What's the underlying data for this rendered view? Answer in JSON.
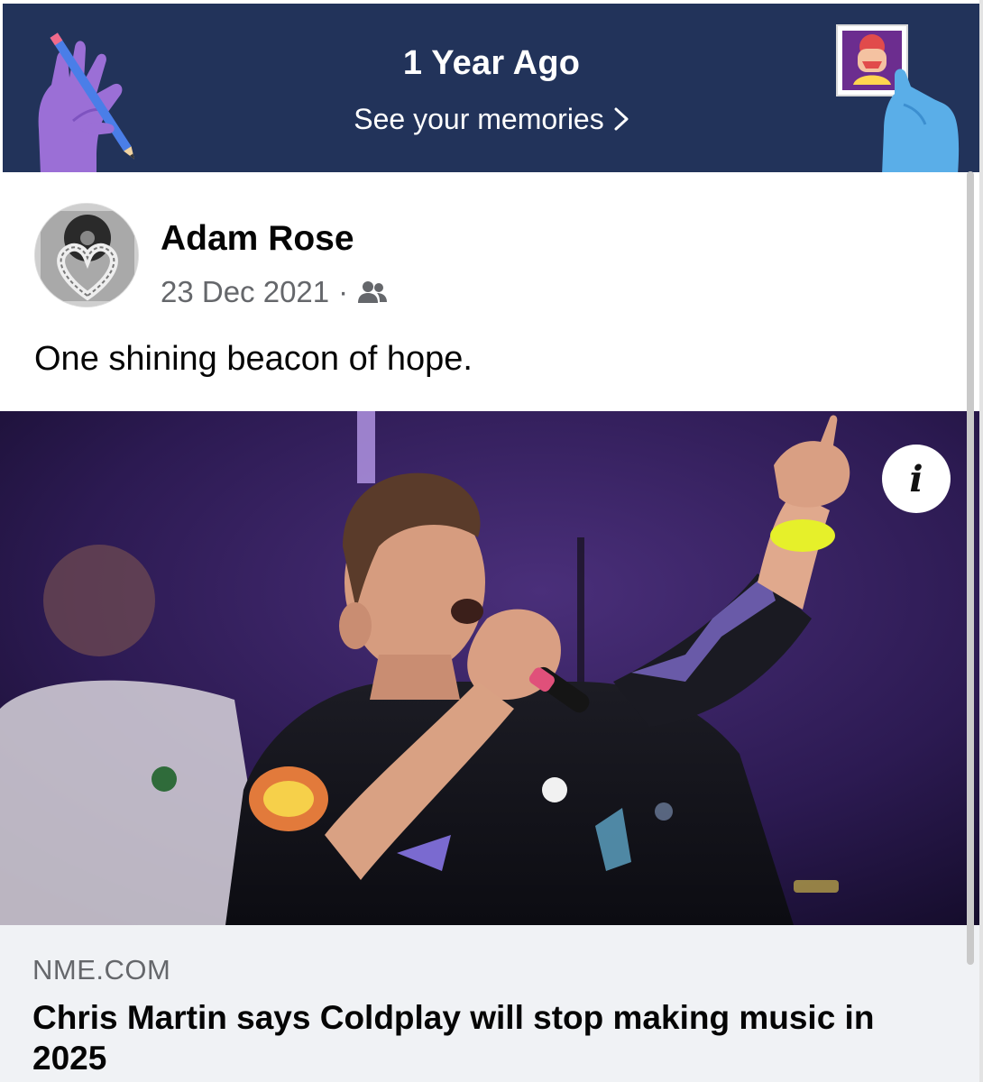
{
  "banner": {
    "title": "1 Year Ago",
    "subtitle": "See your memories",
    "background": "#22335a"
  },
  "post": {
    "author": "Adam Rose",
    "date": "23 Dec 2021",
    "separator": "·",
    "audience_icon": "friends-icon",
    "text": "One shining beacon of hope."
  },
  "link": {
    "domain": "NME.COM",
    "title": "Chris Martin says Coldplay will stop making music in 2025",
    "info_icon": "info-icon",
    "info_glyph": "i"
  }
}
